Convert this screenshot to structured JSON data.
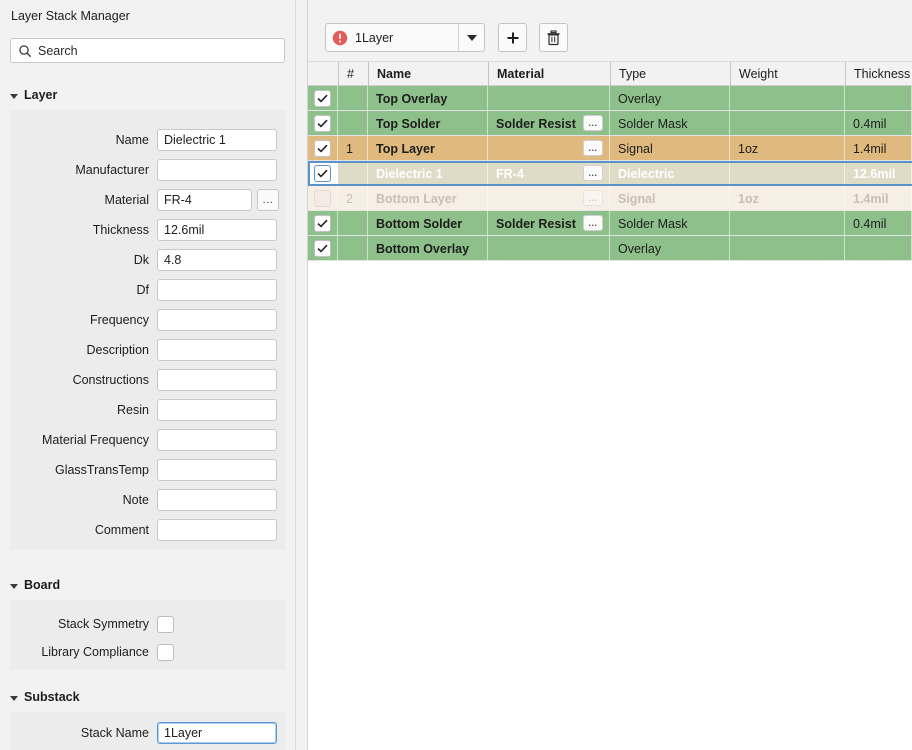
{
  "panel": {
    "title": "Layer Stack Manager",
    "search": {
      "placeholder": "Search",
      "icon": "search-icon"
    }
  },
  "sections": {
    "layer": {
      "title": "Layer",
      "fields": [
        {
          "label": "Name",
          "value": "Dielectric 1",
          "has_browse": false
        },
        {
          "label": "Manufacturer",
          "value": "",
          "has_browse": false
        },
        {
          "label": "Material",
          "value": "FR-4",
          "has_browse": true,
          "browse_label": "..."
        },
        {
          "label": "Thickness",
          "value": "12.6mil",
          "has_browse": false
        },
        {
          "label": "Dk",
          "value": "4.8",
          "has_browse": false
        },
        {
          "label": "Df",
          "value": "",
          "has_browse": false
        },
        {
          "label": "Frequency",
          "value": "",
          "has_browse": false
        },
        {
          "label": "Description",
          "value": "",
          "has_browse": false
        },
        {
          "label": "Constructions",
          "value": "",
          "has_browse": false
        },
        {
          "label": "Resin",
          "value": "",
          "has_browse": false
        },
        {
          "label": "Material Frequency",
          "value": "",
          "has_browse": false
        },
        {
          "label": "GlassTransTemp",
          "value": "",
          "has_browse": false
        },
        {
          "label": "Note",
          "value": "",
          "has_browse": false
        },
        {
          "label": "Comment",
          "value": "",
          "has_browse": false
        }
      ]
    },
    "board": {
      "title": "Board",
      "checkboxes": [
        {
          "label": "Stack Symmetry",
          "checked": false
        },
        {
          "label": "Library Compliance",
          "checked": false
        }
      ]
    },
    "substack": {
      "title": "Substack",
      "fields": [
        {
          "label": "Stack Name",
          "value": "1Layer",
          "focused": true
        }
      ]
    }
  },
  "toolbar": {
    "stack_name": "1Layer",
    "status_icon": "error-icon",
    "dropdown_icon": "chevron-down-icon",
    "add_label": "+",
    "add_icon": "plus-icon",
    "delete_icon": "trash-icon"
  },
  "table": {
    "columns": [
      "",
      "#",
      "Name",
      "Material",
      "Type",
      "Weight",
      "Thickness"
    ],
    "rows": [
      {
        "checked": true,
        "checkbox_state": "checked",
        "num": "",
        "name": "Top Overlay",
        "material": "",
        "has_browse": false,
        "type": "Overlay",
        "weight": "",
        "thickness": "",
        "style": "green"
      },
      {
        "checked": true,
        "checkbox_state": "checked",
        "num": "",
        "name": "Top Solder",
        "material": "Solder Resist",
        "has_browse": true,
        "type": "Solder Mask",
        "weight": "",
        "thickness": "0.4mil",
        "style": "green"
      },
      {
        "checked": true,
        "checkbox_state": "checked",
        "num": "1",
        "name": "Top Layer",
        "material": "",
        "has_browse": true,
        "type": "Signal",
        "weight": "1oz",
        "thickness": "1.4mil",
        "style": "copper"
      },
      {
        "checked": true,
        "checkbox_state": "checked",
        "num": "",
        "name": "Dielectric 1",
        "material": "FR-4",
        "has_browse": true,
        "type": "Dielectric",
        "weight": "",
        "thickness": "12.6mil",
        "style": "sel"
      },
      {
        "checked": false,
        "checkbox_state": "unchecked",
        "num": "2",
        "name": "Bottom Layer",
        "material": "",
        "has_browse": true,
        "type": "Signal",
        "weight": "1oz",
        "thickness": "1.4mil",
        "style": "dim"
      },
      {
        "checked": true,
        "checkbox_state": "checked",
        "num": "",
        "name": "Bottom Solder",
        "material": "Solder Resist",
        "has_browse": true,
        "type": "Solder Mask",
        "weight": "",
        "thickness": "0.4mil",
        "style": "green"
      },
      {
        "checked": true,
        "checkbox_state": "checked",
        "num": "",
        "name": "Bottom Overlay",
        "material": "",
        "has_browse": false,
        "type": "Overlay",
        "weight": "",
        "thickness": "",
        "style": "green"
      }
    ],
    "browse_label": "..."
  },
  "colors": {
    "green_row": "#8dc08a",
    "copper_row": "#dfb97d",
    "selected_row": "#dedcc6",
    "disabled_row": "#f6efe6",
    "selection_border": "#5b93c9",
    "error_red": "#e35b5b",
    "panel_bg": "#f2f2f2"
  }
}
